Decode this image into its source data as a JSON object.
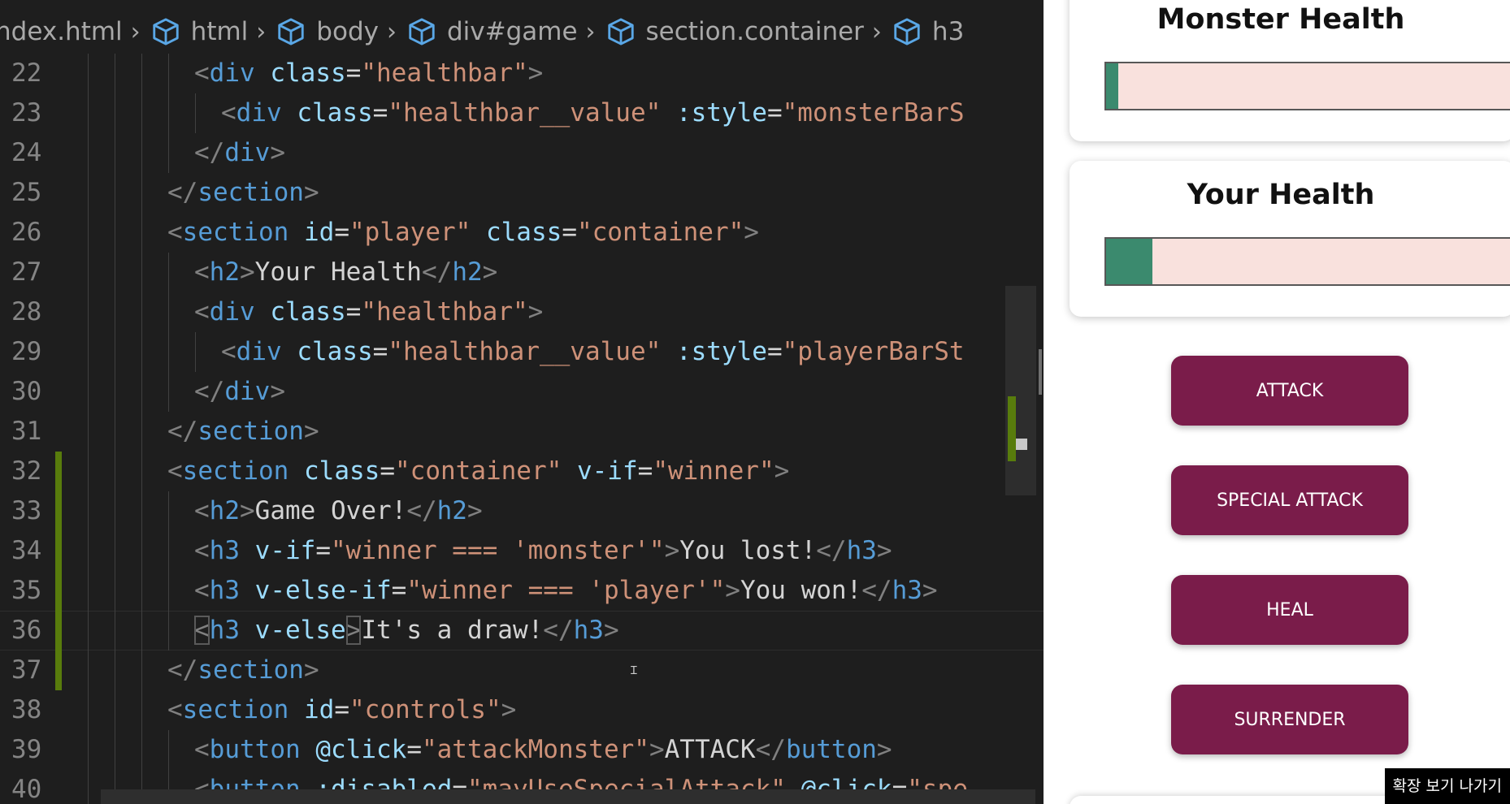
{
  "breadcrumb": [
    {
      "label": "ndex.html",
      "icon": "none"
    },
    {
      "label": "html",
      "icon": "cube-icon"
    },
    {
      "label": "body",
      "icon": "cube-icon"
    },
    {
      "label": "div#game",
      "icon": "cube-icon"
    },
    {
      "label": "section.container",
      "icon": "cube-icon"
    },
    {
      "label": "h3",
      "icon": "cube-icon"
    }
  ],
  "code_lines": [
    {
      "n": "22",
      "indent": 4,
      "modified": false
    },
    {
      "n": "23",
      "indent": 5,
      "modified": false
    },
    {
      "n": "24",
      "indent": 4,
      "modified": false
    },
    {
      "n": "25",
      "indent": 3,
      "modified": false
    },
    {
      "n": "26",
      "indent": 3,
      "modified": false
    },
    {
      "n": "27",
      "indent": 4,
      "modified": false
    },
    {
      "n": "28",
      "indent": 4,
      "modified": false
    },
    {
      "n": "29",
      "indent": 5,
      "modified": false
    },
    {
      "n": "30",
      "indent": 4,
      "modified": false
    },
    {
      "n": "31",
      "indent": 3,
      "modified": false
    },
    {
      "n": "32",
      "indent": 3,
      "modified": true
    },
    {
      "n": "33",
      "indent": 4,
      "modified": true
    },
    {
      "n": "34",
      "indent": 4,
      "modified": true
    },
    {
      "n": "35",
      "indent": 4,
      "modified": true
    },
    {
      "n": "36",
      "indent": 4,
      "modified": true,
      "current": true
    },
    {
      "n": "37",
      "indent": 3,
      "modified": true
    },
    {
      "n": "38",
      "indent": 3,
      "modified": false
    },
    {
      "n": "39",
      "indent": 4,
      "modified": false
    },
    {
      "n": "40",
      "indent": 4,
      "modified": false
    }
  ],
  "code_tokens": [
    [
      [
        "p",
        "<"
      ],
      [
        "t",
        "div"
      ],
      [
        "x",
        " "
      ],
      [
        "a",
        "class"
      ],
      [
        "x",
        "="
      ],
      [
        "s",
        "\"healthbar\""
      ],
      [
        "p",
        ">"
      ]
    ],
    [
      [
        "p",
        "<"
      ],
      [
        "t",
        "div"
      ],
      [
        "x",
        " "
      ],
      [
        "a",
        "class"
      ],
      [
        "x",
        "="
      ],
      [
        "s",
        "\"healthbar__value\""
      ],
      [
        "x",
        " "
      ],
      [
        "a",
        ":style"
      ],
      [
        "x",
        "="
      ],
      [
        "s",
        "\"monsterBarS"
      ]
    ],
    [
      [
        "p",
        "</"
      ],
      [
        "t",
        "div"
      ],
      [
        "p",
        ">"
      ]
    ],
    [
      [
        "p",
        "</"
      ],
      [
        "t",
        "section"
      ],
      [
        "p",
        ">"
      ]
    ],
    [
      [
        "p",
        "<"
      ],
      [
        "t",
        "section"
      ],
      [
        "x",
        " "
      ],
      [
        "a",
        "id"
      ],
      [
        "x",
        "="
      ],
      [
        "s",
        "\"player\""
      ],
      [
        "x",
        " "
      ],
      [
        "a",
        "class"
      ],
      [
        "x",
        "="
      ],
      [
        "s",
        "\"container\""
      ],
      [
        "p",
        ">"
      ]
    ],
    [
      [
        "p",
        "<"
      ],
      [
        "t",
        "h2"
      ],
      [
        "p",
        ">"
      ],
      [
        "x",
        "Your Health"
      ],
      [
        "p",
        "</"
      ],
      [
        "t",
        "h2"
      ],
      [
        "p",
        ">"
      ]
    ],
    [
      [
        "p",
        "<"
      ],
      [
        "t",
        "div"
      ],
      [
        "x",
        " "
      ],
      [
        "a",
        "class"
      ],
      [
        "x",
        "="
      ],
      [
        "s",
        "\"healthbar\""
      ],
      [
        "p",
        ">"
      ]
    ],
    [
      [
        "p",
        "<"
      ],
      [
        "t",
        "div"
      ],
      [
        "x",
        " "
      ],
      [
        "a",
        "class"
      ],
      [
        "x",
        "="
      ],
      [
        "s",
        "\"healthbar__value\""
      ],
      [
        "x",
        " "
      ],
      [
        "a",
        ":style"
      ],
      [
        "x",
        "="
      ],
      [
        "s",
        "\"playerBarSt"
      ]
    ],
    [
      [
        "p",
        "</"
      ],
      [
        "t",
        "div"
      ],
      [
        "p",
        ">"
      ]
    ],
    [
      [
        "p",
        "</"
      ],
      [
        "t",
        "section"
      ],
      [
        "p",
        ">"
      ]
    ],
    [
      [
        "p",
        "<"
      ],
      [
        "t",
        "section"
      ],
      [
        "x",
        " "
      ],
      [
        "a",
        "class"
      ],
      [
        "x",
        "="
      ],
      [
        "s",
        "\"container\""
      ],
      [
        "x",
        " "
      ],
      [
        "a",
        "v-if"
      ],
      [
        "x",
        "="
      ],
      [
        "s",
        "\"winner\""
      ],
      [
        "p",
        ">"
      ]
    ],
    [
      [
        "p",
        "<"
      ],
      [
        "t",
        "h2"
      ],
      [
        "p",
        ">"
      ],
      [
        "x",
        "Game Over!"
      ],
      [
        "p",
        "</"
      ],
      [
        "t",
        "h2"
      ],
      [
        "p",
        ">"
      ]
    ],
    [
      [
        "p",
        "<"
      ],
      [
        "t",
        "h3"
      ],
      [
        "x",
        " "
      ],
      [
        "a",
        "v-if"
      ],
      [
        "x",
        "="
      ],
      [
        "s",
        "\"winner === 'monster'\""
      ],
      [
        "p",
        ">"
      ],
      [
        "x",
        "You lost!"
      ],
      [
        "p",
        "</"
      ],
      [
        "t",
        "h3"
      ],
      [
        "p",
        ">"
      ]
    ],
    [
      [
        "p",
        "<"
      ],
      [
        "t",
        "h3"
      ],
      [
        "x",
        " "
      ],
      [
        "a",
        "v-else-if"
      ],
      [
        "x",
        "="
      ],
      [
        "s",
        "\"winner === 'player'\""
      ],
      [
        "p",
        ">"
      ],
      [
        "x",
        "You won!"
      ],
      [
        "p",
        "</"
      ],
      [
        "t",
        "h3"
      ],
      [
        "p",
        ">"
      ]
    ],
    [
      [
        "pb",
        "<"
      ],
      [
        "t",
        "h3"
      ],
      [
        "x",
        " "
      ],
      [
        "a",
        "v-else"
      ],
      [
        "pb",
        ">"
      ],
      [
        "x",
        "It's a draw!"
      ],
      [
        "p",
        "</"
      ],
      [
        "t",
        "h3"
      ],
      [
        "p",
        ">"
      ]
    ],
    [
      [
        "p",
        "</"
      ],
      [
        "t",
        "section"
      ],
      [
        "p",
        ">"
      ]
    ],
    [
      [
        "p",
        "<"
      ],
      [
        "t",
        "section"
      ],
      [
        "x",
        " "
      ],
      [
        "a",
        "id"
      ],
      [
        "x",
        "="
      ],
      [
        "s",
        "\"controls\""
      ],
      [
        "p",
        ">"
      ]
    ],
    [
      [
        "p",
        "<"
      ],
      [
        "t",
        "button"
      ],
      [
        "x",
        " "
      ],
      [
        "a",
        "@click"
      ],
      [
        "x",
        "="
      ],
      [
        "s",
        "\"attackMonster\""
      ],
      [
        "p",
        ">"
      ],
      [
        "x",
        "ATTACK"
      ],
      [
        "p",
        "</"
      ],
      [
        "t",
        "button"
      ],
      [
        "p",
        ">"
      ]
    ],
    [
      [
        "p",
        "<"
      ],
      [
        "t",
        "button"
      ],
      [
        "x",
        " "
      ],
      [
        "a",
        ":disabled"
      ],
      [
        "x",
        "="
      ],
      [
        "s",
        "\"mayUseSpecialAttack\""
      ],
      [
        "x",
        " "
      ],
      [
        "a",
        "@click"
      ],
      [
        "x",
        "="
      ],
      [
        "s",
        "\"spe"
      ]
    ]
  ],
  "preview": {
    "monster": {
      "title": "Monster Health",
      "health_fraction": 0.03
    },
    "player": {
      "title": "Your Health",
      "health_fraction": 0.11
    },
    "buttons": {
      "attack": "ATTACK",
      "special_attack": "SPECIAL ATTACK",
      "heal": "HEAL",
      "surrender": "SURRENDER"
    }
  },
  "overlay": {
    "exit_fullscreen": "확장 보기 나가기"
  },
  "colors": {
    "editor_bg": "#1e1e1e",
    "tag": "#569cd6",
    "attribute": "#9cdcfe",
    "string": "#ce9178",
    "button_bg": "#7a1c4a",
    "health_fill": "#3b8a6e",
    "health_track": "#f9e1dd",
    "modified_gutter": "#587c0c"
  }
}
